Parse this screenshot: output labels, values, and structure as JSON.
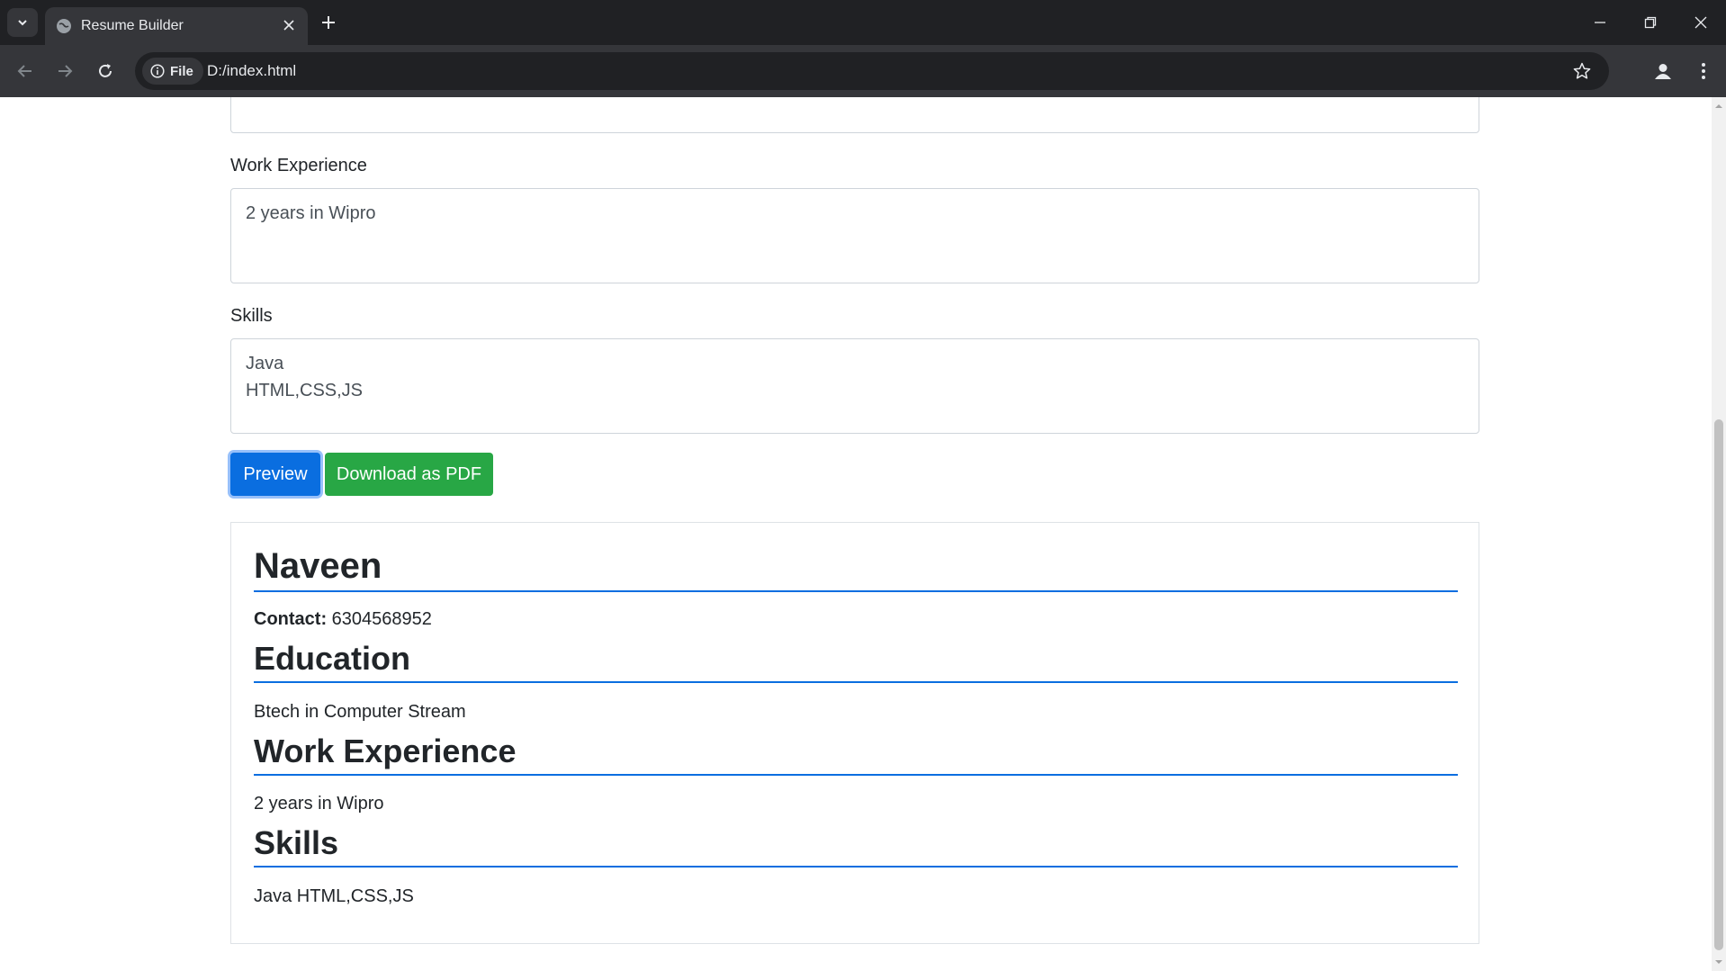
{
  "browser": {
    "tab_title": "Resume Builder",
    "chip_label": "File",
    "url": "D:/index.html",
    "icons": [
      "tab-search-icon",
      "globe-icon",
      "close-icon",
      "plus-icon",
      "minimize-icon",
      "restore-icon",
      "window-close-icon",
      "back-icon",
      "forward-icon",
      "reload-icon",
      "info-icon",
      "star-icon",
      "profile-icon",
      "menu-icon"
    ]
  },
  "form": {
    "work_experience_label": "Work Experience",
    "work_experience_value": "2 years in Wipro",
    "skills_label": "Skills",
    "skills_value": "Java\nHTML,CSS,JS",
    "preview_button": "Preview",
    "download_button": "Download as PDF"
  },
  "preview": {
    "name": "Naveen",
    "contact_label": "Contact:",
    "contact_value": "6304568952",
    "education_heading": "Education",
    "education_value": "Btech in Computer Stream",
    "work_heading": "Work Experience",
    "work_value": "2 years in Wipro",
    "skills_heading": "Skills",
    "skills_value": "Java HTML,CSS,JS"
  },
  "colors": {
    "primary": "#0a6ee0",
    "success": "#28a745",
    "chrome_dark": "#202124",
    "chrome_toolbar": "#35363a"
  }
}
